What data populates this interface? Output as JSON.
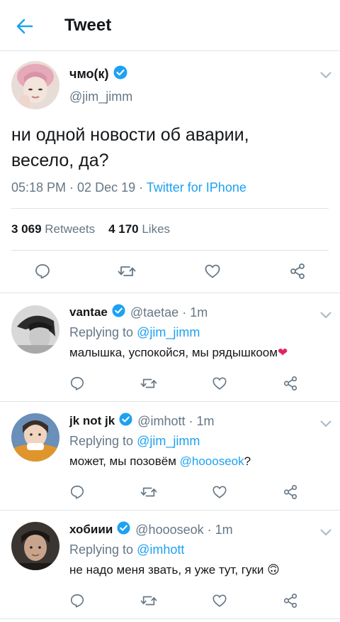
{
  "header": {
    "title": "Tweet"
  },
  "main_tweet": {
    "display_name": "чмо(к)",
    "handle": "@jim_jimm",
    "text_line1": "ни одной новости об аварии,",
    "text_line2": "весело, да?",
    "time": "05:18 PM · 02 Dec 19 · ",
    "source": "Twitter for IPhone",
    "retweets_count": "3 069",
    "retweets_label": "Retweets",
    "likes_count": "4 170",
    "likes_label": "Likes"
  },
  "replies": [
    {
      "display_name": "vantae",
      "handle": "@taetae",
      "time": "· 1m",
      "replying_prefix": "Replying to ",
      "replying_to": "@jim_jimm",
      "text_before": "малышка, успокойся, мы рядышкоом",
      "mention": "",
      "text_after": "",
      "emoji": "❤"
    },
    {
      "display_name": "jk not jk",
      "handle": "@imhott",
      "time": "· 1m",
      "replying_prefix": "Replying to ",
      "replying_to": "@jim_jimm",
      "text_before": "может, мы позовём ",
      "mention": "@hoooseok",
      "text_after": "?",
      "emoji": ""
    },
    {
      "display_name": "хобиии",
      "handle": "@hoooseok",
      "time": "· 1m",
      "replying_prefix": "Replying to ",
      "replying_to": "@imhott",
      "text_before": "не надо меня звать, я уже тут, гуки ",
      "mention": "",
      "text_after": "",
      "emoji": "🙃"
    }
  ],
  "colors": {
    "accent": "#1da1f2",
    "text": "#14171a",
    "muted": "#657786",
    "border": "#dfe3e6"
  }
}
